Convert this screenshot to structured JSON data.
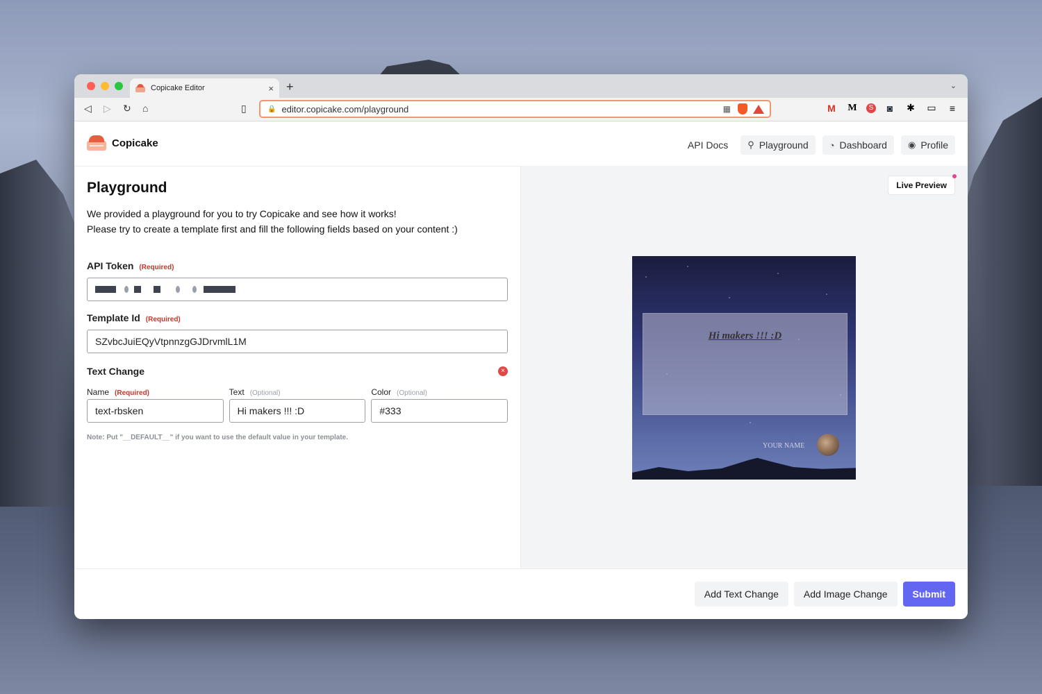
{
  "browser": {
    "tab_title": "Copicake Editor",
    "tab_close": "×",
    "new_tab": "+",
    "url": "editor.copicake.com/playground"
  },
  "header": {
    "brand": "Copicake",
    "nav": {
      "api_docs": "API Docs",
      "playground": "Playground",
      "dashboard": "Dashboard",
      "profile": "Profile"
    }
  },
  "main": {
    "title": "Playground",
    "description_line1": "We provided a playground for you to try Copicake and see how it works!",
    "description_line2": "Please try to create a template first and fill the following fields based on your content :)",
    "api_token": {
      "label": "API Token",
      "required": "(Required)"
    },
    "template_id": {
      "label": "Template Id",
      "required": "(Required)",
      "value": "SZvbcJuiEQyVtpnnzgGJDrvmlL1M"
    },
    "text_change": {
      "title": "Text Change",
      "name_label": "Name",
      "name_required": "(Required)",
      "name_value": "text-rbsken",
      "text_label": "Text",
      "text_optional": "(Optional)",
      "text_value": "Hi makers !!! :D",
      "color_label": "Color",
      "color_optional": "(Optional)",
      "color_value": "#333",
      "note": "Note: Put \"__DEFAULT__\" if you want to use the default value in your template."
    }
  },
  "preview": {
    "badge": "Live Preview",
    "text": "Hi makers !!! :D",
    "your_name": "YOUR NAME"
  },
  "footer": {
    "add_text_change": "Add Text Change",
    "add_image_change": "Add Image Change",
    "submit": "Submit"
  },
  "colors": {
    "accent": "#6366f1",
    "required": "#c0392b",
    "live_dot": "#e8468c"
  }
}
